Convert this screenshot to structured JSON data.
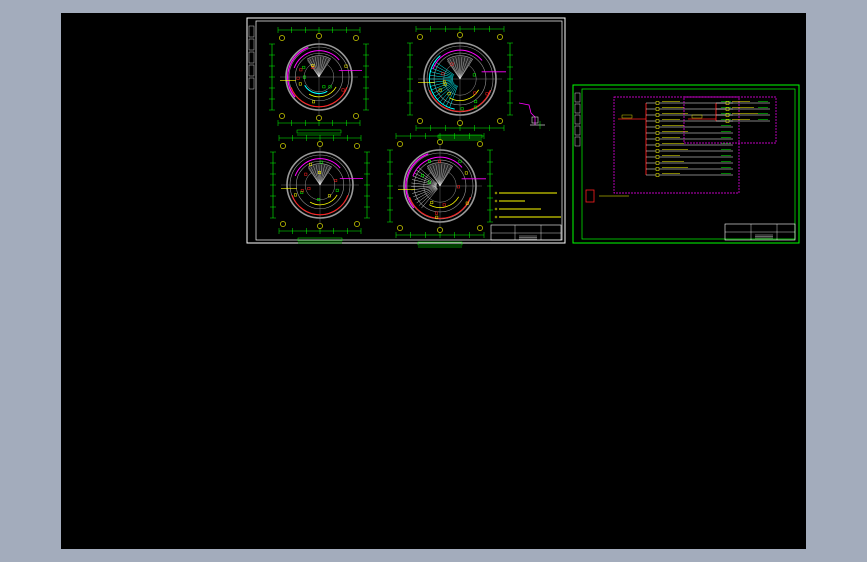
{
  "viewer": {
    "background_color": "#a3acbc",
    "canvas_color": "#000000"
  },
  "sheets": [
    {
      "name": "floor-plans-sheet",
      "frame_color": "#ffffff",
      "plan_count": 4,
      "note_lines": 4
    },
    {
      "name": "distribution-diagram-sheet",
      "frame_color": "#00ff00",
      "left_panel_rows": 13,
      "right_panel_rows": 4
    }
  ],
  "colors": {
    "green": "#00ff00",
    "yellow": "#ffff00",
    "magenta": "#ff00ff",
    "red": "#ff2020",
    "cyan": "#00ffff",
    "white": "#ffffff",
    "gray": "#9a9a9a"
  }
}
